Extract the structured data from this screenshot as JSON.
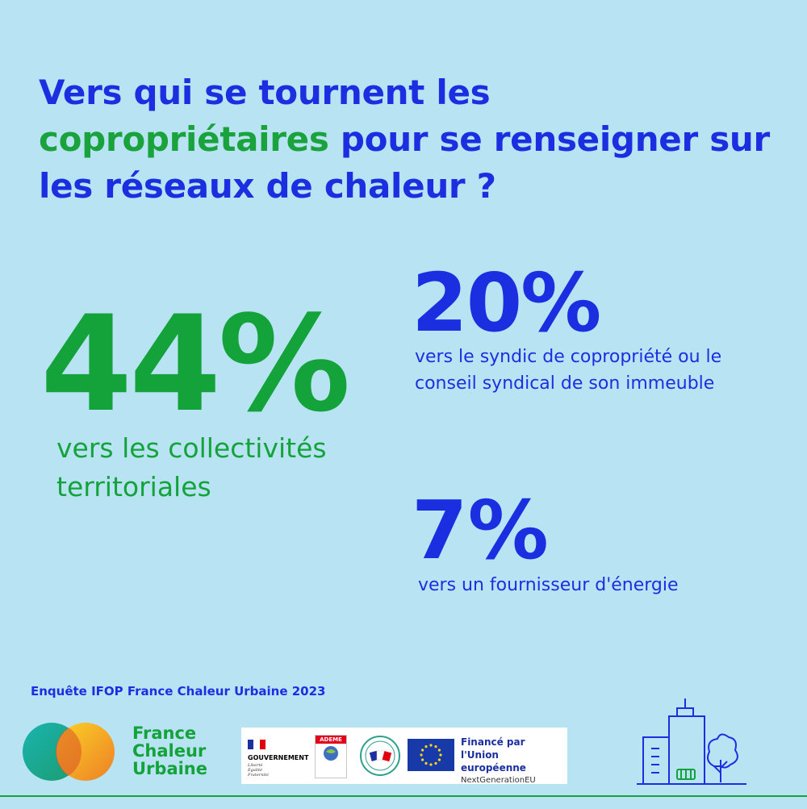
{
  "title": {
    "part1": "Vers qui se tournent les ",
    "highlight": "copropriétaires",
    "part2": " pour se renseigner sur les réseaux de chaleur ?"
  },
  "stats": [
    {
      "value": "44%",
      "label": "vers les collectivités territoriales"
    },
    {
      "value": "20%",
      "label": "vers le syndic de copropriété ou le conseil syndical de son immeuble"
    },
    {
      "value": "7%",
      "label": "vers un fournisseur d'énergie"
    }
  ],
  "source": "Enquête IFOP France Chaleur Urbaine 2023",
  "brand": {
    "line1": "France",
    "line2": "Chaleur",
    "line3": "Urbaine"
  },
  "partners": {
    "gov": "GOUVERNEMENT",
    "gov_motto1": "Liberté",
    "gov_motto2": "Égalité",
    "gov_motto3": "Fraternité",
    "ademe": "ADEME",
    "relance": "FRANCE RELANCE",
    "eu_line1": "Financé par",
    "eu_line2": "l'Union européenne",
    "eu_line3": "NextGenerationEU"
  },
  "colors": {
    "background": "#b8e3f3",
    "blue": "#1b2fe0",
    "green": "#14a33a"
  }
}
